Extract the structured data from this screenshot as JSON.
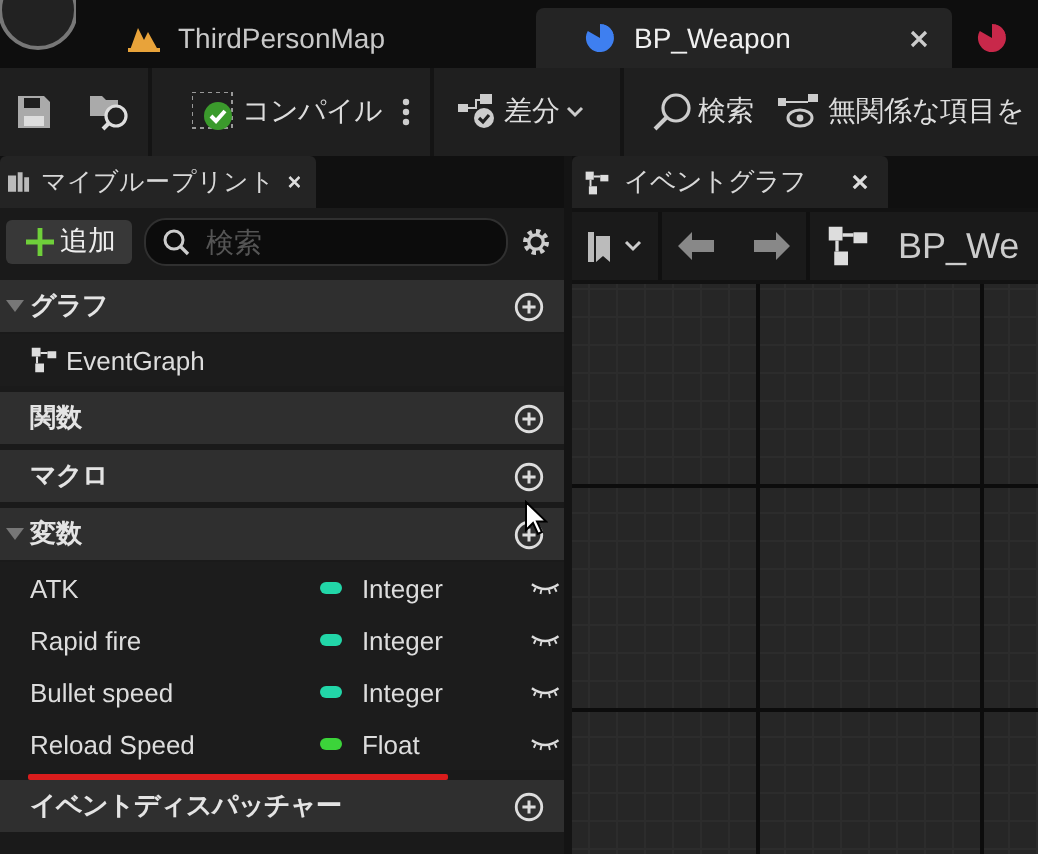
{
  "document_tabs": [
    {
      "kind": "level",
      "label": "ThirdPersonMap",
      "selected": false
    },
    {
      "kind": "blueprint",
      "label": "BP_Weapon",
      "selected": true
    },
    {
      "kind": "blueprint-red",
      "selected": false
    }
  ],
  "toolbar": {
    "compile": "コンパイル",
    "diff": "差分",
    "search": "検索",
    "hide_unrelated": "無関係な項目を"
  },
  "my_blueprint": {
    "title": "マイブループリント",
    "add_button": "追加",
    "search": {
      "placeholder": "検索"
    },
    "sections": [
      {
        "label": "グラフ",
        "expanded": true,
        "items": [
          {
            "kind": "graph",
            "name": "EventGraph"
          }
        ]
      },
      {
        "label": "関数",
        "expanded": false
      },
      {
        "label": "マクロ",
        "expanded": false
      },
      {
        "label": "変数",
        "expanded": true,
        "items": [
          {
            "kind": "variable",
            "name": "ATK",
            "type": "Integer",
            "color": "#22d6a8"
          },
          {
            "kind": "variable",
            "name": "Rapid fire",
            "type": "Integer",
            "color": "#22d6a8"
          },
          {
            "kind": "variable",
            "name": "Bullet speed",
            "type": "Integer",
            "color": "#22d6a8"
          },
          {
            "kind": "variable",
            "name": "Reload Speed",
            "type": "Float",
            "color": "#3cd43a"
          }
        ]
      },
      {
        "label": "イベントディスパッチャー",
        "expanded": false
      }
    ]
  },
  "graph_panel": {
    "tab": "イベントグラフ",
    "breadcrumb": "BP_We"
  }
}
